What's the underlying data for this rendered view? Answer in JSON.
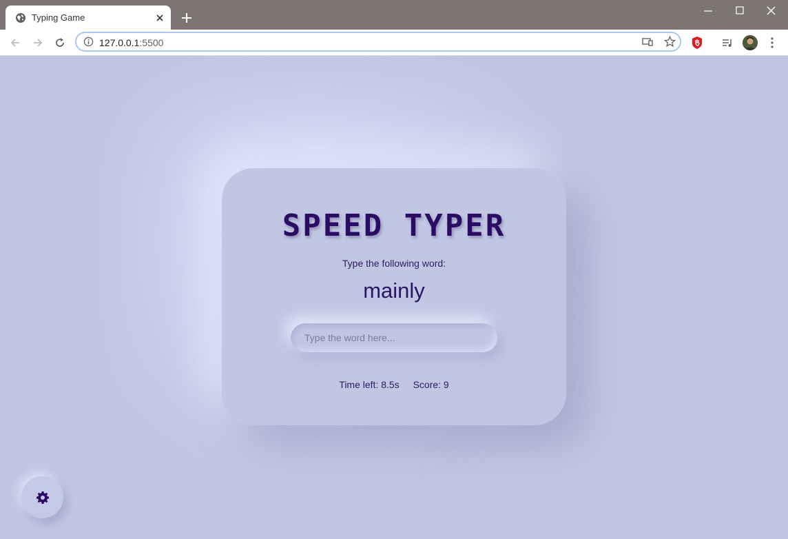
{
  "browser": {
    "tab_title": "Typing Game",
    "url_host": "127.0.0.1",
    "url_port": ":5500",
    "icons": [
      "globe-icon",
      "close-icon",
      "plus-icon",
      "minimize-icon",
      "maximize-icon",
      "back-icon",
      "forward-icon",
      "reload-icon",
      "info-icon",
      "cast-icon",
      "star-icon",
      "extension-icon",
      "media-icon",
      "avatar",
      "menu-icon"
    ]
  },
  "game": {
    "title": "SPEED TYPER",
    "prompt": "Type the following word:",
    "word": "mainly",
    "input_placeholder": "Type the word here...",
    "input_value": "",
    "time_left": "Time left: 8.5s",
    "score": "Score: 9"
  },
  "settings": {
    "icon": "gear-icon"
  },
  "colors": {
    "background": "#c1c7e3",
    "accent": "#2a0d63",
    "chrome": "#7d7574"
  }
}
